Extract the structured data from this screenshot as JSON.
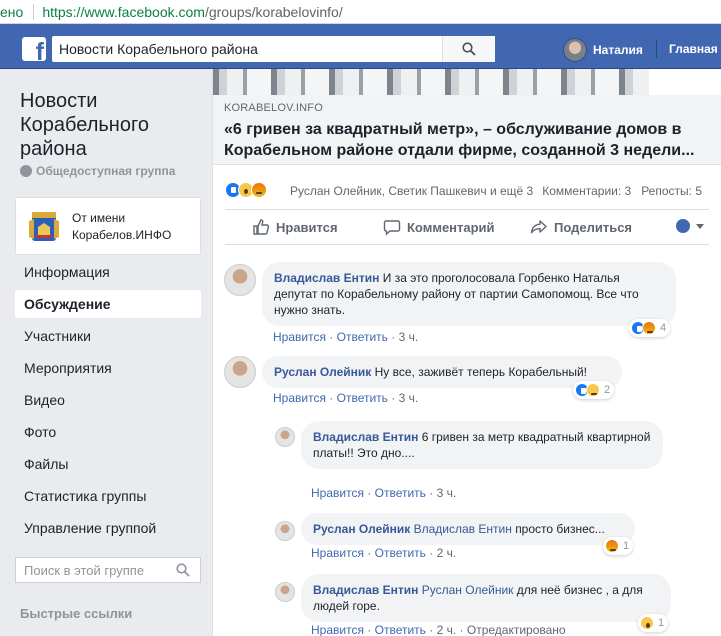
{
  "browser": {
    "secure_label": "ено",
    "url_host": "https://www.facebook.com",
    "url_path": "/groups/korabelovinfo/"
  },
  "header": {
    "search_value": "Новости Корабельного района",
    "user_name": "Наталия",
    "home_label": "Главная",
    "brand_color": "#4267b2"
  },
  "sidebar": {
    "group_title": "Новости Корабельного района",
    "group_type": "Общедоступная группа",
    "acting_as": "От имени Корабелов.ИНФО",
    "nav": [
      {
        "label": "Информация",
        "active": false
      },
      {
        "label": "Обсуждение",
        "active": true
      },
      {
        "label": "Участники",
        "active": false
      },
      {
        "label": "Мероприятия",
        "active": false
      },
      {
        "label": "Видео",
        "active": false
      },
      {
        "label": "Фото",
        "active": false
      },
      {
        "label": "Файлы",
        "active": false
      },
      {
        "label": "Статистика группы",
        "active": false
      },
      {
        "label": "Управление группой",
        "active": false
      }
    ],
    "search_placeholder": "Поиск в этой группе",
    "quick_links": "Быстрые ссылки"
  },
  "post": {
    "link_domain": "KORABELOV.INFO",
    "link_title": "«6 гривен за квадратный метр», – обслуживание домов в Корабельном районе отдали фирме, созданной 3 недели...",
    "reaction_names": "Руслан Олейник, Светик Пашкевич и ещё 3",
    "comments_count": "Комментарии: 3",
    "shares_count": "Репосты: 5",
    "actions": {
      "like": "Нравится",
      "comment": "Комментарий",
      "share": "Поделиться"
    }
  },
  "comments": [
    {
      "author": "Владислав Ентин",
      "text": "И за это проголосовала Горбенко Наталья депутат по Корабельному району от партии Самопомощ. Все что нужно знать.",
      "like": "Нравится",
      "reply": "Ответить",
      "time": "3 ч.",
      "reactions": "4"
    },
    {
      "author": "Руслан Олейник",
      "text": "Ну все, заживёт теперь Корабельный!",
      "like": "Нравится",
      "reply": "Ответить",
      "time": "3 ч.",
      "reactions": "2"
    }
  ],
  "replies": [
    {
      "author": "Владислав Ентин",
      "mention": "",
      "text": "6 гривен за метр квадратный квартирной платы!! Это дно....",
      "like": "Нравится",
      "reply": "Ответить",
      "time": "3 ч.",
      "reactions": ""
    },
    {
      "author": "Руслан Олейник",
      "mention": "Владислав Ентин",
      "text": "просто бизнес...",
      "like": "Нравится",
      "reply": "Ответить",
      "time": "2 ч.",
      "reactions": "1"
    },
    {
      "author": "Владислав Ентин",
      "mention": "Руслан Олейник",
      "text": "для неё бизнес , а для людей горе.",
      "like": "Нравится",
      "reply": "Ответить",
      "time": "2 ч.",
      "edited": "Отредактировано",
      "reactions": "1"
    }
  ]
}
